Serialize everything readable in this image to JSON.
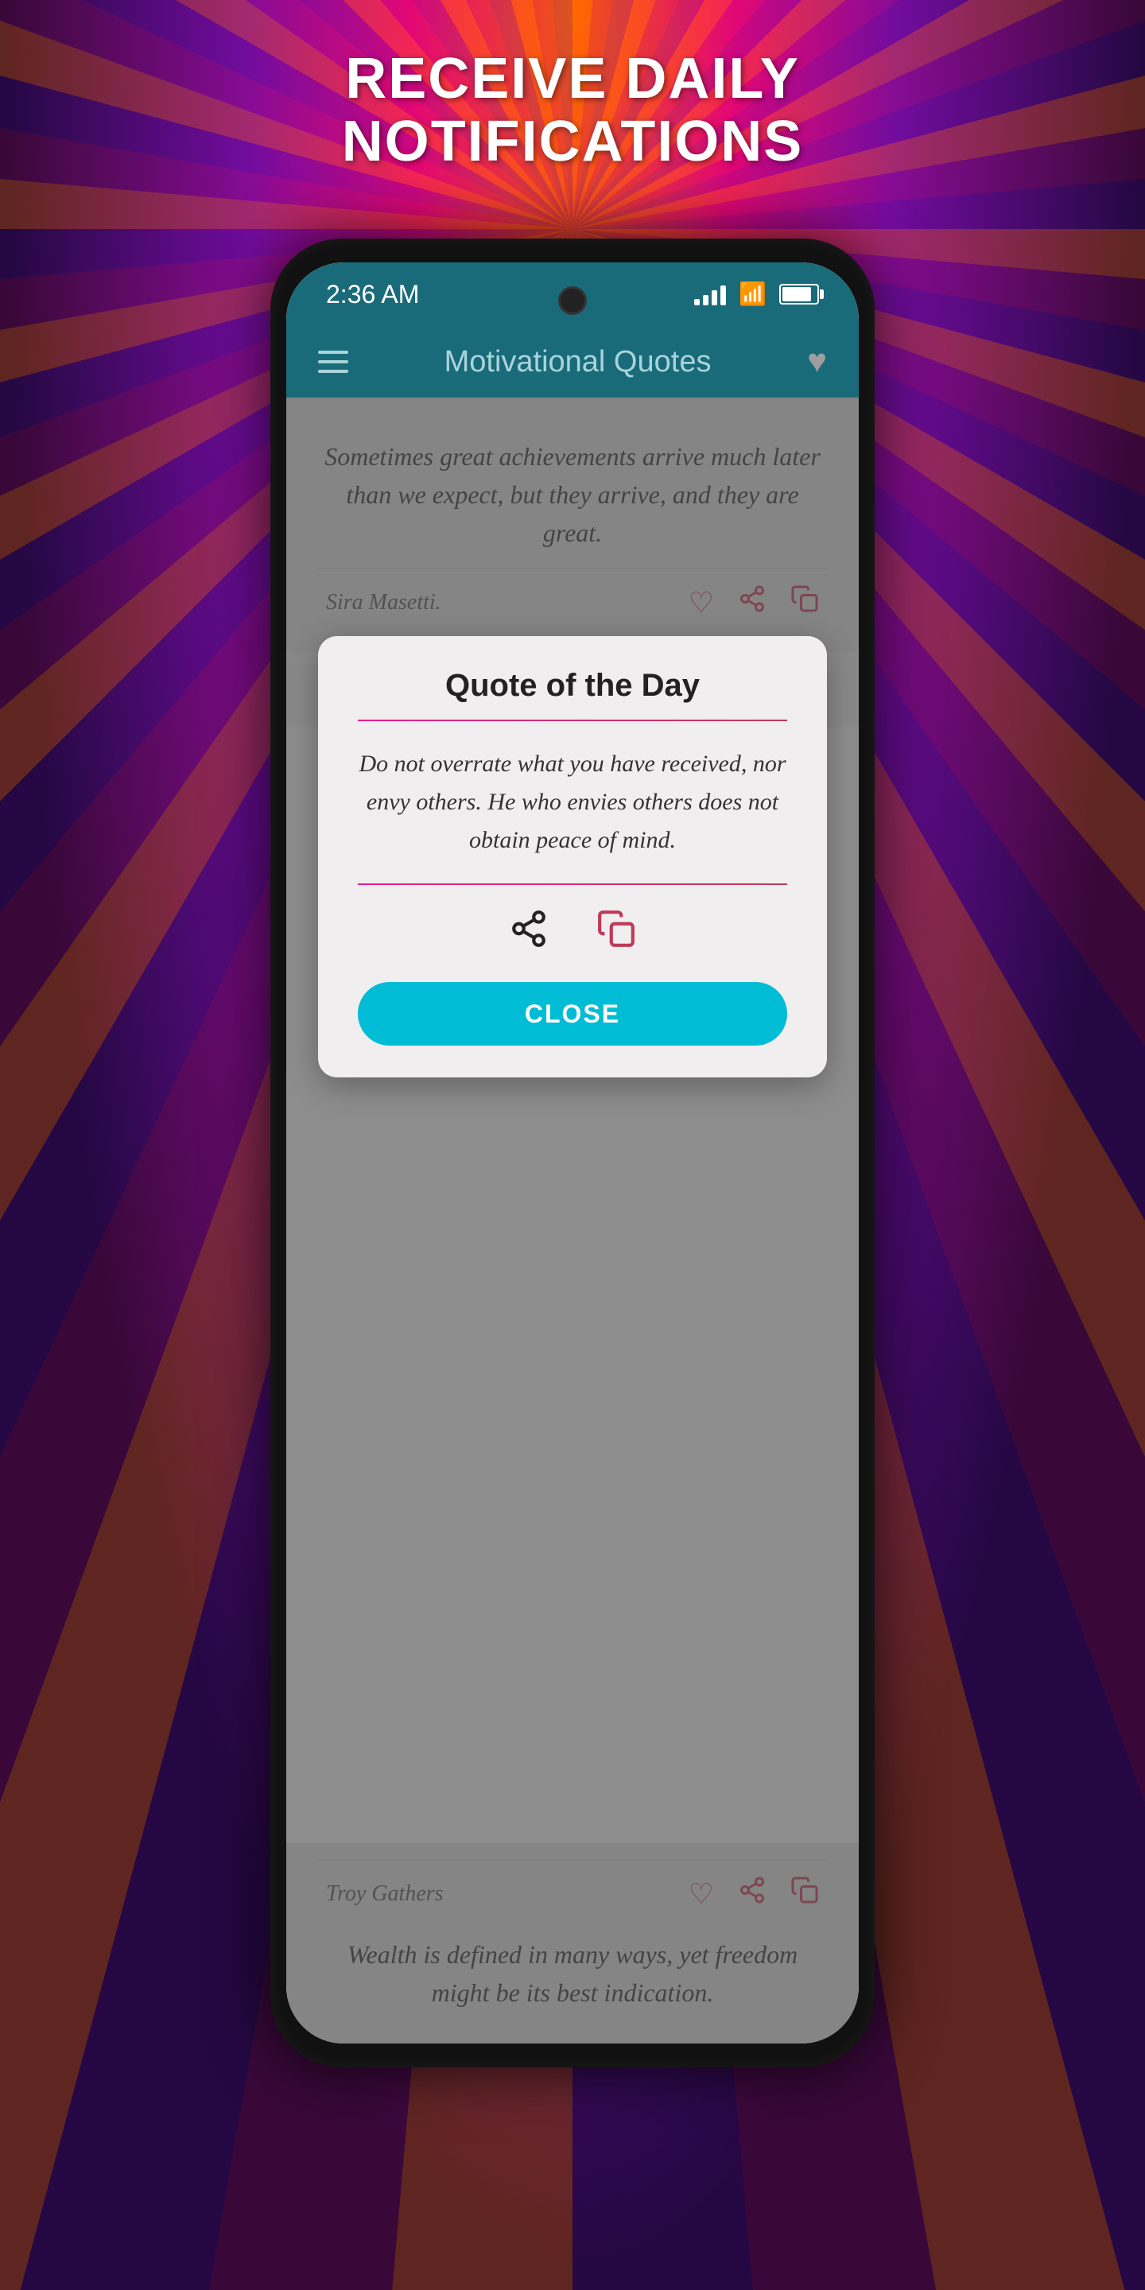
{
  "background": {
    "promo_line1": "RECEIVE DAILY",
    "promo_line2": "NOTIFICATIONS"
  },
  "status_bar": {
    "time": "2:36 AM"
  },
  "app_header": {
    "title": "Motivational Quotes"
  },
  "quote1": {
    "text": "Sometimes great achievements arrive much later than we expect, but they arrive, and they are great.",
    "author": "Sira Masetti."
  },
  "modal": {
    "title": "Quote of the Day",
    "quote": "Do not overrate what you have received, nor envy others. He who envies others does not obtain peace of mind.",
    "close_label": "CLOSE"
  },
  "quote2": {
    "author": "Troy Gathers"
  },
  "quote3": {
    "text": "Wealth is defined in many ways, yet freedom might be its best indication."
  },
  "icons": {
    "heart_outline": "♡",
    "heart_filled": "♥",
    "share": "⇧",
    "copy": "⧉",
    "hamburger": "≡"
  }
}
